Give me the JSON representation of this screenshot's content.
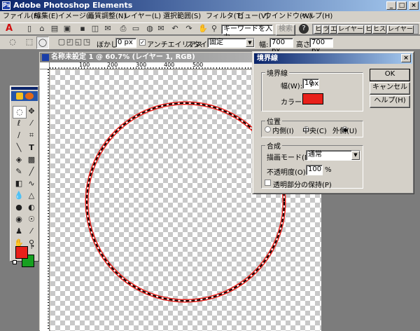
{
  "app": {
    "title": "Adobe Photoshop Elements",
    "win_min": "_",
    "win_max": "□",
    "win_close": "×"
  },
  "menu": [
    "ファイル(F)",
    "編集(E)",
    "イメージ(I)",
    "画質調整(N)",
    "レイヤー(L)",
    "選択範囲(S)",
    "フィルタ(T)",
    "ビュー(V)",
    "ウインドウ(W)",
    "ヘルプ(H)"
  ],
  "toolbar": {
    "search_placeholder": "キーワードを入力",
    "search_button": "検索",
    "palette_tabs": [
      "ヒ",
      "ラ",
      "エ",
      "レイヤー",
      "ヒ",
      "ヒス",
      "レイヤー"
    ]
  },
  "options": {
    "feather_label": "ぼかし:",
    "feather_value": "0 px",
    "antialias_label": "アンチエイリアス",
    "antialias_checked": true,
    "style_label": "スタイル:",
    "style_value": "固定",
    "width_label": "幅:",
    "width_value": "700 px",
    "height_label": "高さ:",
    "height_value": "700 px"
  },
  "document": {
    "title": "名称未設定 1 @ 60.7% (レイヤー 1, RGB)",
    "ruler_labels": [
      "100",
      "200",
      "300",
      "400",
      "500"
    ],
    "circle_stroke_color": "#e8201a"
  },
  "toolbox": {
    "foreground_color": "#e8201a",
    "background_color": "#17a020"
  },
  "dialog": {
    "title": "境界線",
    "close": "×",
    "group_stroke": "境界線",
    "width_label": "幅(W):",
    "width_value": "10",
    "width_unit": "px",
    "color_label": "カラー:",
    "color_value": "#e8201a",
    "group_location": "位置",
    "loc_inside": "内側(I)",
    "loc_center": "中央(C)",
    "loc_outside": "外側(U)",
    "loc_selected": "outside",
    "group_blend": "合成",
    "mode_label": "描画モード(M):",
    "mode_value": "通常",
    "opacity_label": "不透明度(O):",
    "opacity_value": "100",
    "opacity_unit": "%",
    "preserve_label": "透明部分の保持(P)",
    "preserve_checked": false,
    "ok": "OK",
    "cancel": "キャンセル",
    "help": "ヘルプ(H)"
  }
}
